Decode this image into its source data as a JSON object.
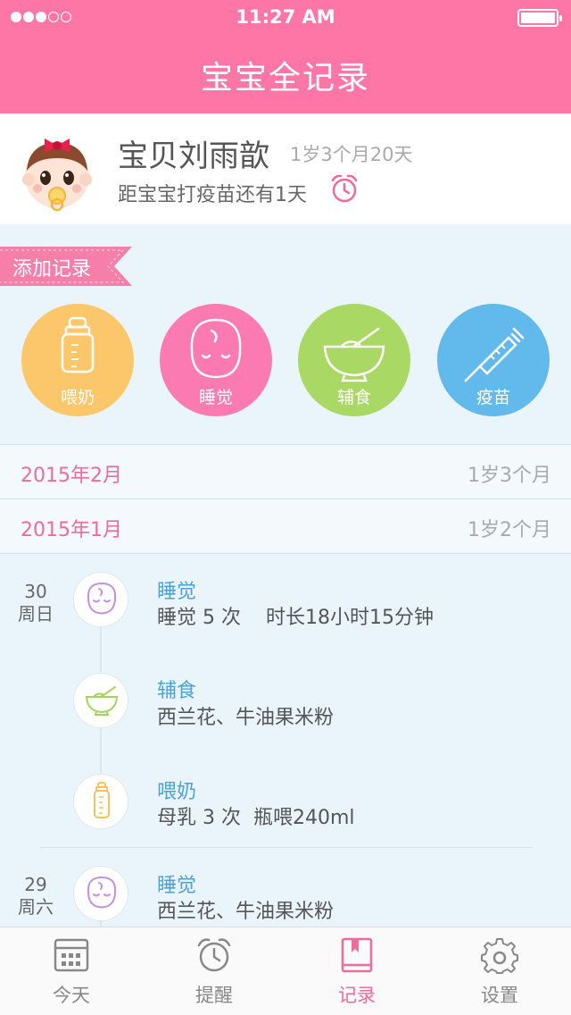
{
  "status_bar": {
    "time": "11:27 AM"
  },
  "header": {
    "title": "宝宝全记录"
  },
  "baby": {
    "name": "宝贝刘雨歆",
    "age": "1岁3个月20天",
    "vaccine_tip": "距宝宝打疫苗还有1天"
  },
  "add_record": {
    "label": "添加记录",
    "buttons": [
      {
        "label": "喂奶",
        "icon": "bottle-icon",
        "color": "#fcc66a"
      },
      {
        "label": "睡觉",
        "icon": "sleep-face-icon",
        "color": "#fb7ab1"
      },
      {
        "label": "辅食",
        "icon": "bowl-icon",
        "color": "#a9d864"
      },
      {
        "label": "疫苗",
        "icon": "syringe-icon",
        "color": "#62b9ec"
      }
    ]
  },
  "months": [
    {
      "month": "2015年2月",
      "age": "1岁3个月"
    },
    {
      "month": "2015年1月",
      "age": "1岁2个月"
    }
  ],
  "timeline": [
    {
      "day": "30",
      "weekday": "周日",
      "entries": [
        {
          "type": "sleep",
          "title": "睡觉",
          "desc": "睡觉 5 次    时长18小时15分钟"
        },
        {
          "type": "food",
          "title": "辅食",
          "desc": "西兰花、牛油果米粉"
        },
        {
          "type": "milk",
          "title": "喂奶",
          "desc": "母乳 3 次  瓶喂240ml"
        }
      ]
    },
    {
      "day": "29",
      "weekday": "周六",
      "entries": [
        {
          "type": "sleep",
          "title": "睡觉",
          "desc": "西兰花、牛油果米粉"
        }
      ]
    }
  ],
  "tabs": [
    {
      "label": "今天",
      "icon": "calendar-icon",
      "active": false
    },
    {
      "label": "提醒",
      "icon": "alarm-clock-icon",
      "active": false
    },
    {
      "label": "记录",
      "icon": "record-book-icon",
      "active": true
    },
    {
      "label": "设置",
      "icon": "gear-icon",
      "active": false
    }
  ],
  "colors": {
    "header": "#fd76a6",
    "accent_pink": "#f06a9c",
    "entry_title_blue": "#4aa3d8",
    "background": "#eaf5fb"
  }
}
